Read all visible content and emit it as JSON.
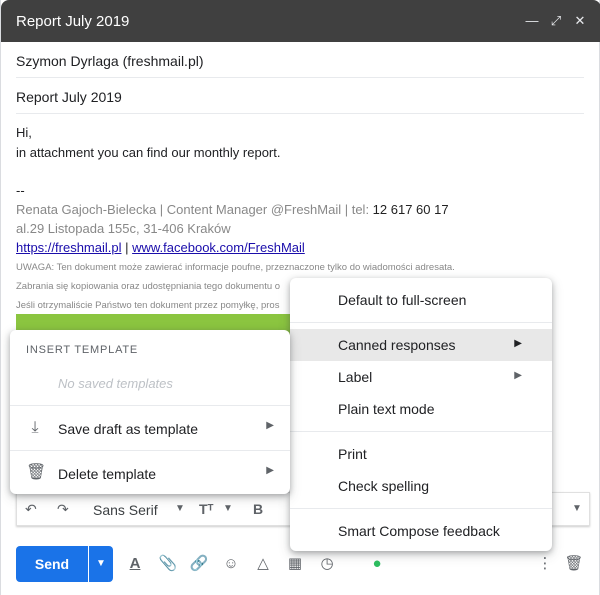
{
  "window": {
    "title": "Report July 2019",
    "minimize_icon": "minimize-icon",
    "expand_icon": "expand-icon",
    "close_icon": "close-icon"
  },
  "compose": {
    "to": "Szymon Dyrlaga (freshmail.pl)",
    "subject": "Report July 2019",
    "body": {
      "greeting": "Hi,",
      "line1": "in attachment you can find our monthly report.",
      "sig_sep": "--",
      "sig_name": "Renata Gajoch-Bielecka | Content Manager @FreshMail | tel: ",
      "sig_phone": "12 617 60 17",
      "sig_address": "al.29 Listopada 155c, 31-406 Kraków",
      "link1": "https://freshmail.pl",
      "link_sep": " | ",
      "link2": "www.facebook.com/FreshMail",
      "notice1": "UWAGA: Ten dokument może zawierać informacje poufne, przeznaczone tylko do wiadomości adresata.",
      "notice2": "Zabrania się kopiowania oraz udostępniania tego dokumentu o",
      "notice3": "Jeśli otrzymaliście Państwo ten dokument przez pomyłkę, pros"
    }
  },
  "format_bar": {
    "font": "Sans Serif"
  },
  "actions": {
    "send_label": "Send"
  },
  "insert_template_menu": {
    "heading": "INSERT TEMPLATE",
    "empty_text": "No saved templates",
    "items": [
      {
        "label": "Save draft as template",
        "icon": "download-icon"
      },
      {
        "label": "Delete template",
        "icon": "trash-icon"
      }
    ]
  },
  "more_options_menu": {
    "items": [
      {
        "label": "Default to full-screen"
      },
      {
        "label": "Canned responses",
        "submenu": true,
        "active": true
      },
      {
        "label": "Label",
        "submenu": true
      },
      {
        "label": "Plain text mode"
      },
      {
        "label": "Print"
      },
      {
        "label": "Check spelling"
      },
      {
        "label": "Smart Compose feedback"
      }
    ]
  },
  "colors": {
    "titlebar": "#404040",
    "send": "#1a73e8",
    "banner": "#8bc540"
  }
}
